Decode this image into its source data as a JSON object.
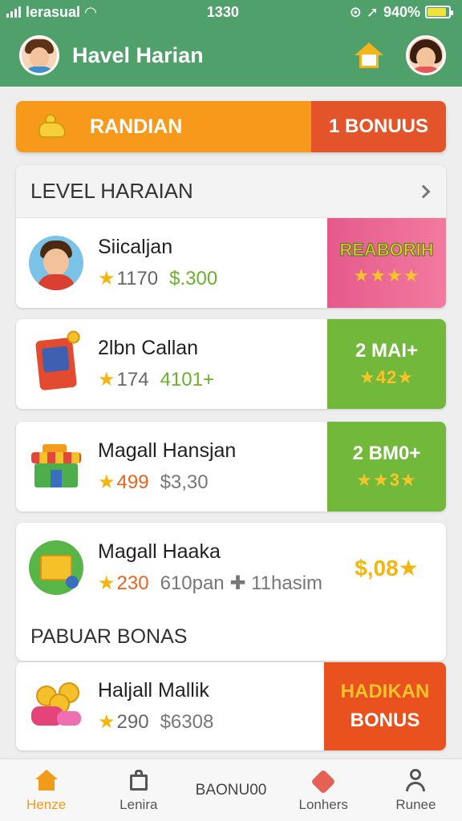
{
  "status": {
    "carrier": "lerasual",
    "time": "1330",
    "battery": "940%",
    "battery_level": 0.9
  },
  "header": {
    "title": "Havel Harian"
  },
  "banner": {
    "left_label": "RANDIAN",
    "right_label": "1 BONUUS"
  },
  "section": {
    "title": "LEVEL HARAIAN",
    "footer_title": "PABUAR BONAS"
  },
  "rows": [
    {
      "title": "Siicaljan",
      "stat_a": "1170",
      "stat_b": "$.300",
      "badge": "REABORIH",
      "badge_stars": "★★★★"
    },
    {
      "title": "2lbn Callan",
      "stat_a": "174",
      "stat_b": "4101+",
      "badge": "2 MAI+",
      "badge_stars": "★42★"
    },
    {
      "title": "Magall Hansjan",
      "stat_a": "499",
      "stat_b": "$3,30",
      "badge": "2 BM0+",
      "badge_stars": "★★3★"
    },
    {
      "title": "Magall Haaka",
      "stat_a": "230",
      "stat_b": "610pan ✚ 11hasim",
      "badge": "$,08★"
    },
    {
      "title": "Haljall Mallik",
      "stat_a": "290",
      "stat_b": "$6308",
      "badge_line1": "HADIKAN",
      "badge_line2": "BONUS"
    }
  ],
  "nav": {
    "home": "Henze",
    "library": "Lenira",
    "center": "BAONU00",
    "lovers": "Lonhers",
    "profile": "Runee"
  },
  "colors": {
    "header_green": "#4fa06a",
    "banner_orange": "#f79a1c",
    "bonus_red": "#e4542a",
    "badge_green": "#72b83b",
    "star_gold": "#f5b50f"
  }
}
